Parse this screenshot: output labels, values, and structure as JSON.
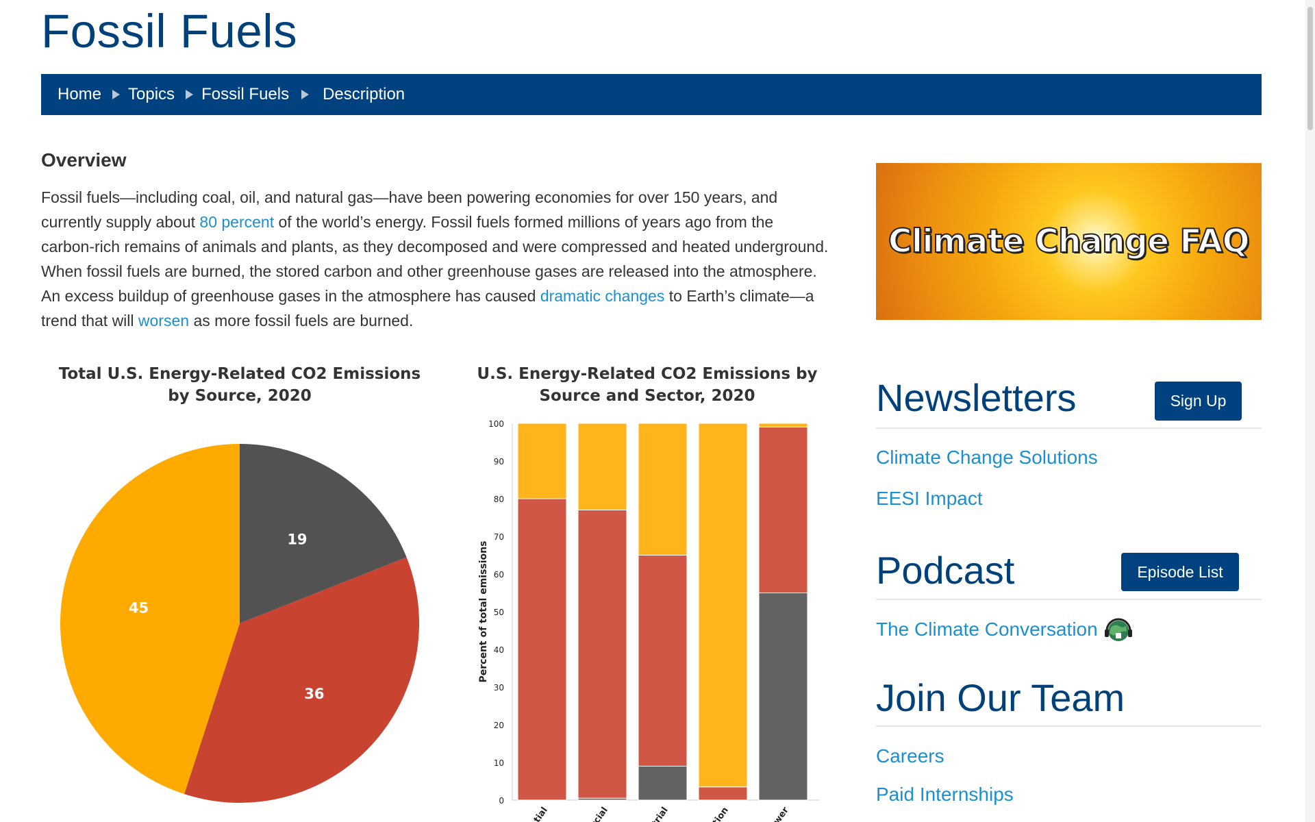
{
  "page": {
    "title": "Fossil Fuels"
  },
  "breadcrumb": [
    "Home",
    "Topics",
    "Fossil Fuels",
    "Description"
  ],
  "overview": {
    "heading": "Overview",
    "p1": "Fossil fuels—including coal, oil, and natural gas—have been powering economies for over 150 years, and currently supply about ",
    "link1": "80 percent",
    "p2": " of the world’s energy. Fossil fuels formed millions of years ago from the carbon-rich remains of animals and plants, as they decomposed and were compressed and heated underground. When fossil fuels are burned, the stored carbon and other greenhouse gases are released into the atmosphere. An excess buildup of greenhouse gases in the atmosphere has caused ",
    "link2": "dramatic changes",
    "p3": " to Earth’s climate—a trend that will ",
    "link3": "worsen",
    "p4": " as more fossil fuels are burned."
  },
  "chart_data": [
    {
      "type": "pie",
      "title": "Total U.S. Energy-Related CO2 Emissions by Source, 2020",
      "slices": [
        {
          "value": 19,
          "label": "19",
          "color": "#525252"
        },
        {
          "value": 36,
          "label": "36",
          "color": "#c94331"
        },
        {
          "value": 45,
          "label": "45",
          "color": "#ffaa00"
        }
      ]
    },
    {
      "type": "bar",
      "stacked": true,
      "title": "U.S. Energy-Related CO2 Emissions by Source and Sector, 2020",
      "ylabel": "Percent of total emissions",
      "ylim": [
        0,
        100
      ],
      "yticks": [
        0,
        10,
        20,
        30,
        40,
        50,
        60,
        70,
        80,
        90,
        100
      ],
      "categories": [
        "...tial",
        "...rcial",
        "...trial",
        "...tion",
        "...wer"
      ],
      "series": [
        {
          "color": "#636363",
          "values": [
            0,
            0.5,
            9,
            0,
            55
          ]
        },
        {
          "color": "#d05745",
          "values": [
            80,
            76.5,
            56,
            3.5,
            44
          ]
        },
        {
          "color": "#fdb51b",
          "values": [
            20,
            23,
            35,
            96.5,
            1
          ]
        }
      ],
      "grid": false
    }
  ],
  "sidebar": {
    "banner_text": "Climate Change FAQ",
    "newsletters": {
      "heading": "Newsletters",
      "button": "Sign Up",
      "links": [
        "Climate Change Solutions",
        "EESI Impact"
      ]
    },
    "podcast": {
      "heading": "Podcast",
      "button": "Episode List",
      "link": "The Climate Conversation"
    },
    "team": {
      "heading": "Join Our Team",
      "links": [
        "Careers",
        "Paid Internships"
      ]
    }
  },
  "colors": {
    "brand_blue": "#00427f",
    "link_blue": "#1a8fd1"
  }
}
